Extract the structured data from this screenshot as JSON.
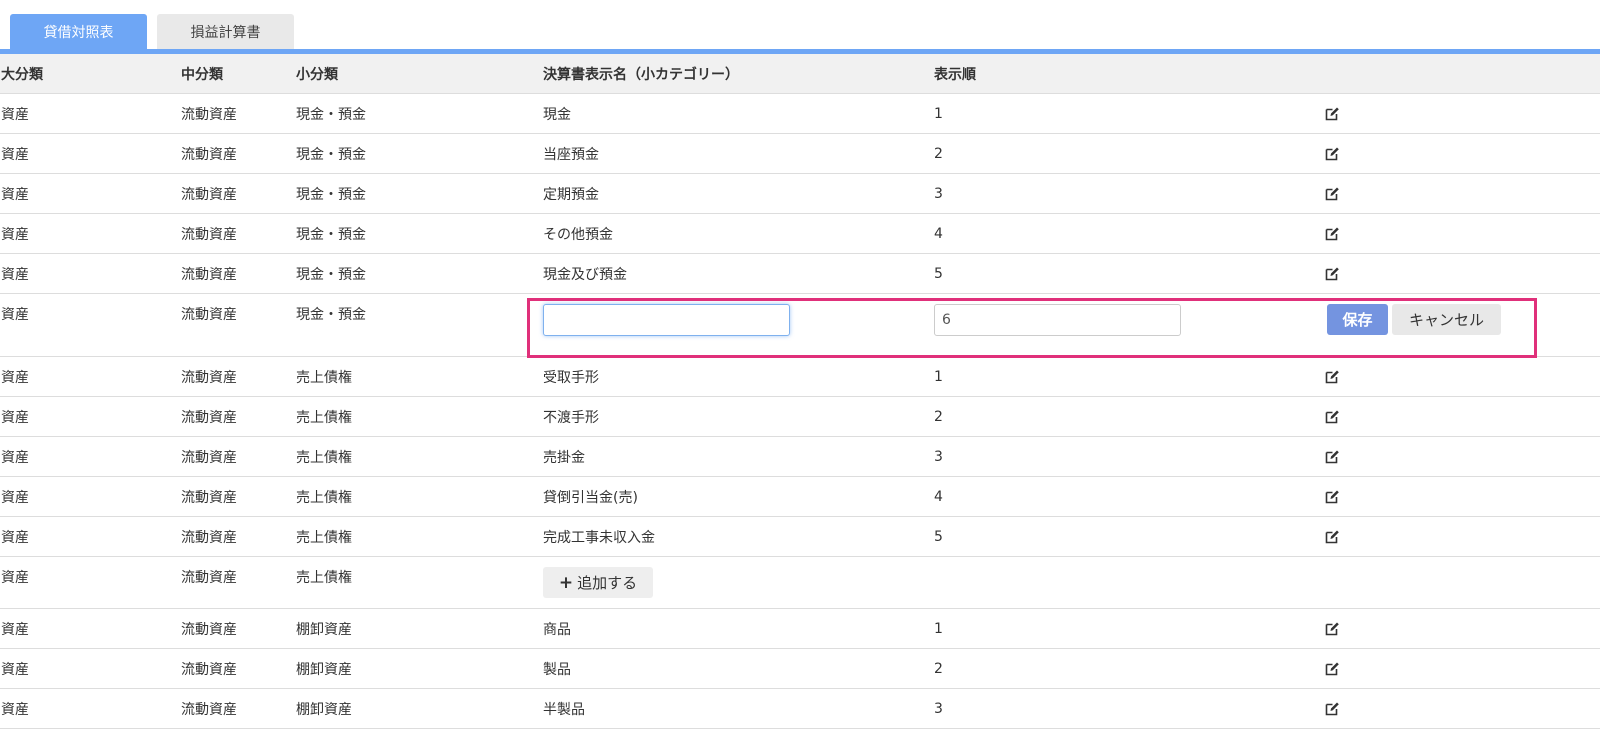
{
  "tabs": [
    {
      "label": "貸借対照表",
      "active": true
    },
    {
      "label": "損益計算書",
      "active": false
    }
  ],
  "colors": {
    "accent": "#6ea6f5",
    "highlight": "#e0307a",
    "save_button": "#7494e0"
  },
  "table": {
    "headers": [
      "大分類",
      "中分類",
      "小分類",
      "決算書表示名（小カテゴリー）",
      "表示順"
    ],
    "rows_group1": [
      {
        "major": "資産",
        "middle": "流動資産",
        "minor": "現金・預金",
        "name": "現金",
        "order": "1"
      },
      {
        "major": "資産",
        "middle": "流動資産",
        "minor": "現金・預金",
        "name": "当座預金",
        "order": "2"
      },
      {
        "major": "資産",
        "middle": "流動資産",
        "minor": "現金・預金",
        "name": "定期預金",
        "order": "3"
      },
      {
        "major": "資産",
        "middle": "流動資産",
        "minor": "現金・預金",
        "name": "その他預金",
        "order": "4"
      },
      {
        "major": "資産",
        "middle": "流動資産",
        "minor": "現金・預金",
        "name": "現金及び預金",
        "order": "5"
      }
    ],
    "edit_row": {
      "major": "資産",
      "middle": "流動資産",
      "minor": "現金・預金",
      "name_value": "",
      "order_value": "6",
      "save_label": "保存",
      "cancel_label": "キャンセル"
    },
    "rows_group2": [
      {
        "major": "資産",
        "middle": "流動資産",
        "minor": "売上債権",
        "name": "受取手形",
        "order": "1"
      },
      {
        "major": "資産",
        "middle": "流動資産",
        "minor": "売上債権",
        "name": "不渡手形",
        "order": "2"
      },
      {
        "major": "資産",
        "middle": "流動資産",
        "minor": "売上債権",
        "name": "売掛金",
        "order": "3"
      },
      {
        "major": "資産",
        "middle": "流動資産",
        "minor": "売上債権",
        "name": "貸倒引当金(売)",
        "order": "4"
      },
      {
        "major": "資産",
        "middle": "流動資産",
        "minor": "売上債権",
        "name": "完成工事未収入金",
        "order": "5"
      }
    ],
    "add_row": {
      "major": "資産",
      "middle": "流動資産",
      "minor": "売上債権",
      "add_label": "追加する"
    },
    "rows_group3": [
      {
        "major": "資産",
        "middle": "流動資産",
        "minor": "棚卸資産",
        "name": "商品",
        "order": "1"
      },
      {
        "major": "資産",
        "middle": "流動資産",
        "minor": "棚卸資産",
        "name": "製品",
        "order": "2"
      },
      {
        "major": "資産",
        "middle": "流動資産",
        "minor": "棚卸資産",
        "name": "半製品",
        "order": "3"
      }
    ]
  }
}
